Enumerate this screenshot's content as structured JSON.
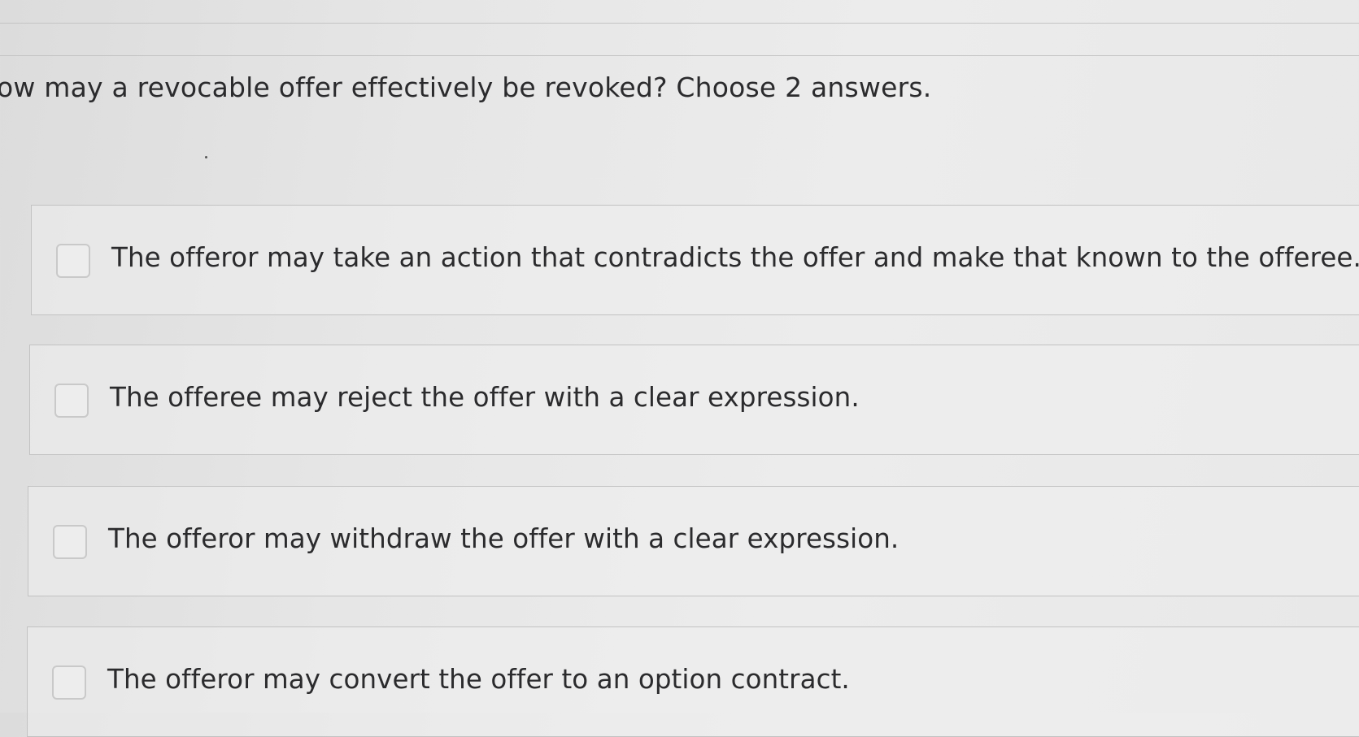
{
  "question": {
    "text": "ow may a revocable offer effectively be revoked? Choose 2 answers."
  },
  "options": [
    {
      "label": "The offeror may take an action that contradicts the offer and make that known to the offeree.",
      "checked": false
    },
    {
      "label": "The offeree may reject the offer with a clear expression.",
      "checked": false
    },
    {
      "label": "The offeror may withdraw the offer with a clear expression.",
      "checked": false
    },
    {
      "label": "The offeror may convert the offer to an option contract.",
      "checked": false
    }
  ]
}
